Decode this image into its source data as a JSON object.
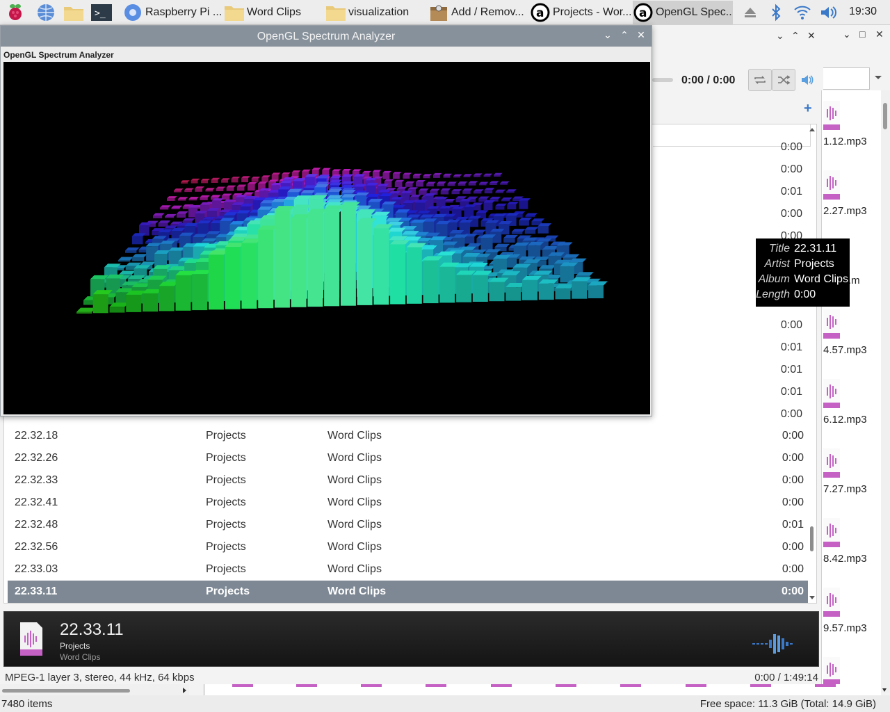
{
  "taskbar": {
    "tasks": [
      {
        "label": "Raspberry Pi ..."
      },
      {
        "label": "Word Clips"
      },
      {
        "label": "visualization"
      },
      {
        "label": "Add / Remov..."
      },
      {
        "label": "Projects - Wor..."
      },
      {
        "label": "OpenGL Spec..."
      }
    ],
    "clock": "19:30"
  },
  "spectrum_window": {
    "title": "OpenGL Spectrum Analyzer",
    "label": "OpenGL Spectrum Analyzer"
  },
  "player": {
    "time_display": "0:00 / 0:00",
    "partial_lengths": [
      "0:00",
      "0:00",
      "0:01",
      "0:00",
      "0:00",
      "0:00",
      "0:01",
      "0:01",
      "0:01",
      "0:00"
    ],
    "playlist": [
      {
        "title": "22.32.18",
        "artist": "Projects",
        "album": "Word Clips",
        "length": "0:00"
      },
      {
        "title": "22.32.26",
        "artist": "Projects",
        "album": "Word Clips",
        "length": "0:00"
      },
      {
        "title": "22.32.33",
        "artist": "Projects",
        "album": "Word Clips",
        "length": "0:00"
      },
      {
        "title": "22.32.41",
        "artist": "Projects",
        "album": "Word Clips",
        "length": "0:00"
      },
      {
        "title": "22.32.48",
        "artist": "Projects",
        "album": "Word Clips",
        "length": "0:01"
      },
      {
        "title": "22.32.56",
        "artist": "Projects",
        "album": "Word Clips",
        "length": "0:00"
      },
      {
        "title": "22.33.03",
        "artist": "Projects",
        "album": "Word Clips",
        "length": "0:00"
      },
      {
        "title": "22.33.11",
        "artist": "Projects",
        "album": "Word Clips",
        "length": "0:00",
        "selected": true
      }
    ],
    "tooltip": {
      "title_key": "Title",
      "title": "22.31.11",
      "artist_key": "Artist",
      "artist": "Projects",
      "album_key": "Album",
      "album": "Word Clips",
      "length_key": "Length",
      "length": "0:00"
    },
    "now_playing": {
      "title": "22.33.11",
      "artist": "Projects",
      "album": "Word Clips"
    },
    "status_left": "MPEG-1 layer 3, stereo, 44 kHz, 64 kbps",
    "status_right": "0:00 / 1:49:14"
  },
  "file_manager": {
    "files": [
      {
        "name": "1.12.mp3"
      },
      {
        "name": "2.27.mp3"
      },
      {
        "name": ".m"
      },
      {
        "name": "4.57.mp3"
      },
      {
        "name": "6.12.mp3"
      },
      {
        "name": "7.27.mp3"
      },
      {
        "name": "8.42.mp3"
      },
      {
        "name": "9.57.mp3"
      },
      {
        "name": ""
      }
    ],
    "item_count": "7480 items",
    "free_space": "Free space: 11.3 GiB (Total: 14.9 GiB)"
  },
  "colors": {
    "accent": "#3a78c8",
    "selection": "#7d8894",
    "titlebar": "#87919b",
    "file_icon": "#c561c5"
  }
}
